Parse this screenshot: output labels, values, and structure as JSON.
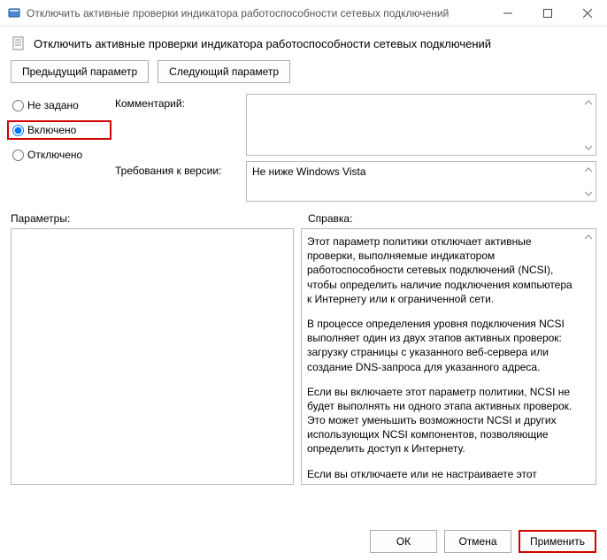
{
  "window": {
    "title": "Отключить активные проверки индикатора работоспособности сетевых подключений"
  },
  "header": {
    "heading": "Отключить активные проверки индикатора работоспособности сетевых подключений"
  },
  "nav": {
    "prev": "Предыдущий параметр",
    "next": "Следующий параметр"
  },
  "radios": {
    "not_set": "Не задано",
    "enabled": "Включено",
    "disabled": "Отключено"
  },
  "labels": {
    "comment": "Комментарий:",
    "requirement": "Требования к версии:",
    "params": "Параметры:",
    "help": "Справка:"
  },
  "fields": {
    "comment": "",
    "requirement": "Не ниже Windows Vista"
  },
  "help": {
    "p1": "Этот параметр политики отключает активные проверки, выполняемые индикатором работоспособности сетевых подключений (NCSI), чтобы определить наличие подключения компьютера к Интернету или к ограниченной сети.",
    "p2": "В процессе определения уровня подключения NCSI выполняет один из двух этапов активных проверок: загрузку страницы с указанного веб-сервера или создание DNS-запроса для указанного адреса.",
    "p3": "Если вы включаете этот параметр политики, NCSI не будет выполнять ни одного этапа активных проверок. Это может уменьшить возможности NCSI и других использующих NCSI компонентов, позволяющие определить доступ к Интернету.",
    "p4": "Если вы отключаете или не настраиваете этот параметр политики, NCSI выполнит один из двух этапов активных проверок."
  },
  "footer": {
    "ok": "ОК",
    "cancel": "Отмена",
    "apply": "Применить"
  }
}
